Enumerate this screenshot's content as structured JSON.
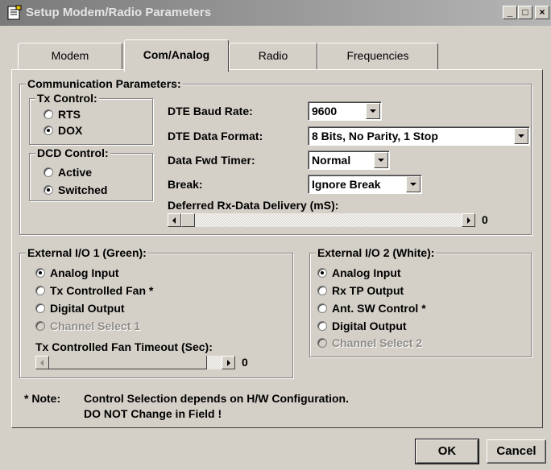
{
  "window": {
    "title": "Setup Modem/Radio Parameters",
    "controls": [
      "_",
      "□",
      "×"
    ]
  },
  "tabs": [
    {
      "label": "Modem",
      "active": false
    },
    {
      "label": "Com/Analog",
      "active": true
    },
    {
      "label": "Radio",
      "active": false
    },
    {
      "label": "Frequencies",
      "active": false
    }
  ],
  "comm": {
    "group_title": "Communication Parameters:",
    "tx_control": {
      "title": "Tx Control:",
      "options": [
        "RTS",
        "DOX"
      ],
      "selected": "DOX"
    },
    "dcd_control": {
      "title": "DCD Control:",
      "options": [
        "Active",
        "Switched"
      ],
      "selected": "Switched"
    },
    "fields": {
      "baud_label": "DTE Baud Rate:",
      "baud_value": "9600",
      "format_label": "DTE Data Format:",
      "format_value": "8 Bits, No Parity, 1 Stop",
      "fwd_label": "Data Fwd Timer:",
      "fwd_value": "Normal",
      "break_label": "Break:",
      "break_value": "Ignore Break",
      "deferred_label": "Deferred Rx-Data Delivery (mS):",
      "deferred_value": "0"
    }
  },
  "ext1": {
    "title": "External I/O 1 (Green):",
    "options": [
      "Analog Input",
      "Tx Controlled Fan *",
      "Digital Output",
      "Channel Select 1"
    ],
    "selected": "Analog Input",
    "disabled": [
      "Channel Select 1"
    ],
    "timeout_label": "Tx Controlled Fan Timeout (Sec):",
    "timeout_value": "0"
  },
  "ext2": {
    "title": "External I/O 2 (White):",
    "options": [
      "Analog Input",
      "Rx TP Output",
      "Ant. SW Control *",
      "Digital Output",
      "Channel Select 2"
    ],
    "selected": "Analog Input",
    "disabled": [
      "Channel Select 2"
    ]
  },
  "note": {
    "prefix": "* Note:",
    "line1": "Control Selection depends on H/W Configuration.",
    "line2": "DO NOT Change in Field !"
  },
  "buttons": {
    "ok": "OK",
    "cancel": "Cancel"
  }
}
